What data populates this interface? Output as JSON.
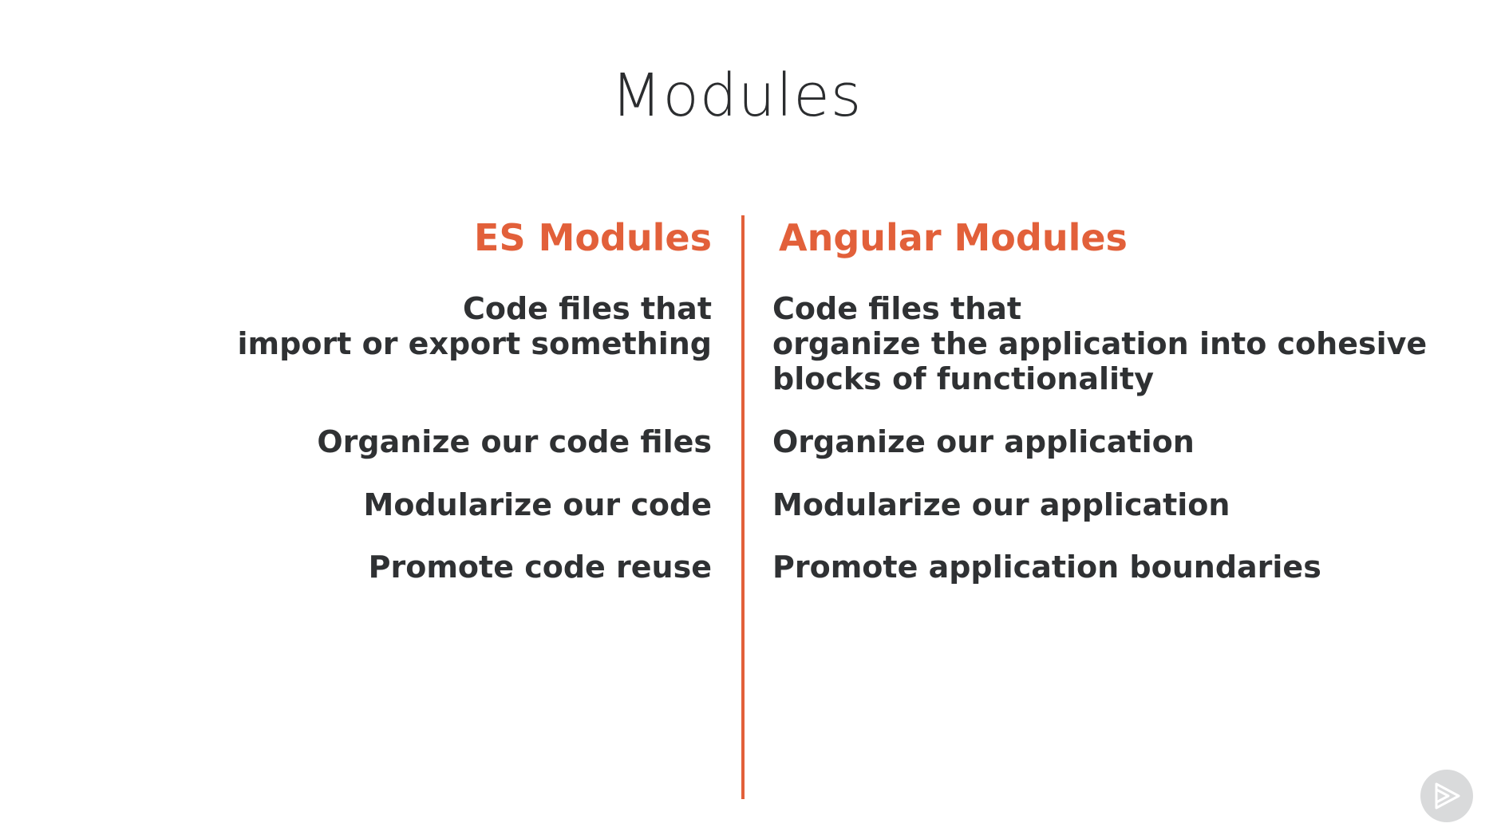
{
  "slide": {
    "title": "Modules"
  },
  "left_column": {
    "heading": "ES Modules",
    "items": [
      {
        "lines": [
          "Code files that",
          "import or export something"
        ]
      },
      {
        "lines": [
          "Organize our code files"
        ]
      },
      {
        "lines": [
          "Modularize our code"
        ]
      },
      {
        "lines": [
          "Promote code reuse"
        ]
      }
    ]
  },
  "right_column": {
    "heading": "Angular Modules",
    "items": [
      {
        "lines": [
          "Code files that",
          "organize the application into cohesive",
          "blocks of functionality"
        ]
      },
      {
        "lines": [
          "Organize our application"
        ]
      },
      {
        "lines": [
          "Modularize our application"
        ]
      },
      {
        "lines": [
          "Promote application boundaries"
        ]
      }
    ]
  },
  "colors": {
    "accent": "#e2603a",
    "text": "#2f3133",
    "background": "#ffffff"
  },
  "icons": {
    "watermark": "play-logo-icon"
  }
}
